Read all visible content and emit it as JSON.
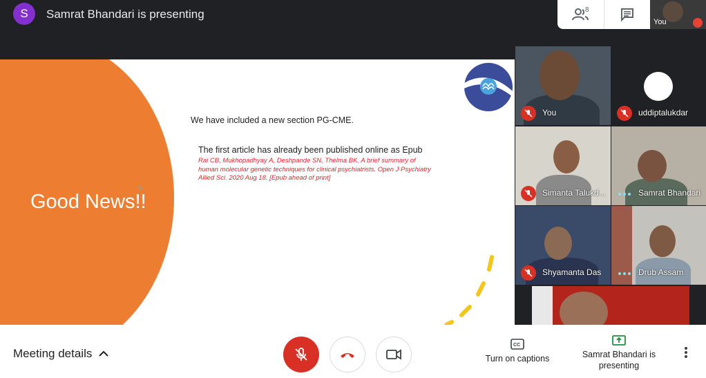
{
  "top": {
    "presenter_initial": "S",
    "presenting_title": "Samrat Bhandari is presenting",
    "people_count": "8",
    "self_label": "You"
  },
  "slide": {
    "heading": "Good News!!",
    "line1": "We have included a new section PG-CME.",
    "line2": "The first article has already been published online as Epub",
    "citation": "Rai CB, Mukhopadhyay A, Deshpande SN, Thelma BK. A brief summary of human molecular genetic techniques for clinical psychiatrists. Open J Psychiatry Allied Sci. 2020 Aug 18. [Epub ahead of print]"
  },
  "participants": [
    {
      "name": "You",
      "muted": true
    },
    {
      "name": "uddiptalukdar",
      "muted": true
    },
    {
      "name": "Simanta Talukd...",
      "muted": true
    },
    {
      "name": "Samrat Bhandari",
      "muted": false
    },
    {
      "name": "Shyamanta Das",
      "muted": true
    },
    {
      "name": "Drub Assam",
      "muted": false
    }
  ],
  "bottom": {
    "meeting_details": "Meeting details",
    "captions_label": "Turn on captions",
    "presenting_label": "Samrat Bhandari is presenting"
  },
  "colors": {
    "accent_orange": "#ed7d31",
    "mute_red": "#d93025",
    "presenter_purple": "#8430ce",
    "present_green": "#1e8e3e"
  }
}
